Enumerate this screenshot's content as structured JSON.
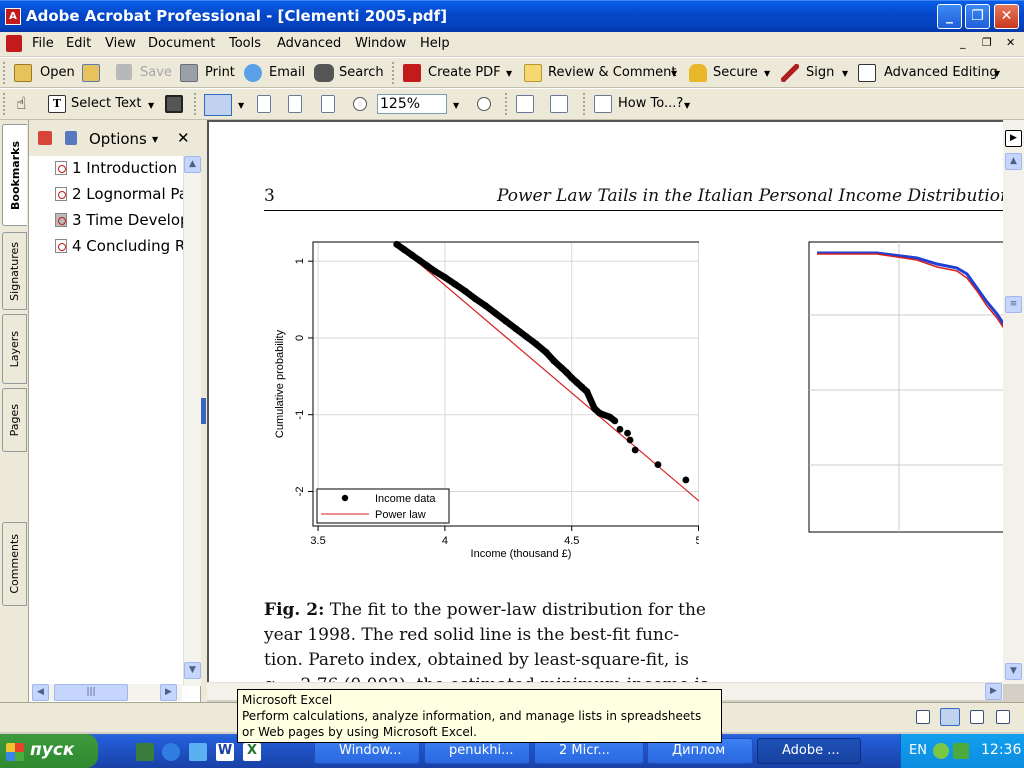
{
  "window": {
    "title": "Adobe Acrobat Professional - [Clementi 2005.pdf]",
    "icon": "acrobat-icon"
  },
  "menu": [
    "File",
    "Edit",
    "View",
    "Document",
    "Tools",
    "Advanced",
    "Window",
    "Help"
  ],
  "toolbar1": {
    "open": "Open",
    "save": "Save",
    "print": "Print",
    "email": "Email",
    "search": "Search",
    "create_pdf": "Create PDF",
    "review": "Review & Comment",
    "secure": "Secure",
    "sign": "Sign",
    "advanced": "Advanced Editing"
  },
  "toolbar2": {
    "select_text": "Select Text",
    "zoom": "125%",
    "howto": "How To...?"
  },
  "side_tabs": [
    "Bookmarks",
    "Signatures",
    "Layers",
    "Pages",
    "Comments"
  ],
  "bookmarks": {
    "options": "Options",
    "items": [
      "1 Introduction",
      "2 Lognormal Pa",
      "3 Time Develop",
      "4 Concluding R"
    ]
  },
  "pdf": {
    "page_number": "3",
    "running_title": "Power Law Tails in the Italian Personal Income Distribution",
    "caption_lines": [
      [
        "Fig. 2:",
        " The fit to the power-law distribution for the"
      ],
      [
        "",
        "year 1998.  The red solid line is the best-fit func-"
      ],
      [
        "",
        "tion.  Pareto index, obtained by least-square-fit, is"
      ],
      [
        "",
        "α = 2.76 (0.002), the estimated minimum income is"
      ]
    ]
  },
  "chart_data": {
    "type": "scatter",
    "title": "",
    "xlabel": "Income (thousand £)",
    "ylabel": "Cumulative probability",
    "xlim": [
      3.48,
      5.12
    ],
    "ylim": [
      -2.45,
      1.25
    ],
    "x_ticks": [
      "3.5",
      "4",
      "4.5",
      "5"
    ],
    "x_tick_values": [
      3.5,
      4.0,
      4.5,
      5.0
    ],
    "y_ticks": [
      "1",
      "0",
      "-1",
      "-2"
    ],
    "y_tick_values": [
      1,
      0,
      -1,
      -2
    ],
    "grid": true,
    "legend_position": "bottom-left",
    "series": [
      {
        "name": "Income data",
        "kind": "points",
        "color": "#000000",
        "x": [
          3.81,
          3.84,
          3.87,
          3.9,
          3.93,
          3.96,
          4.0,
          4.04,
          4.08,
          4.12,
          4.16,
          4.2,
          4.24,
          4.28,
          4.32,
          4.36,
          4.4,
          4.43,
          4.46,
          4.48,
          4.5,
          4.52,
          4.54,
          4.56,
          4.59,
          4.61,
          4.65,
          4.67,
          4.69,
          4.72,
          4.73,
          4.75,
          4.84,
          4.95,
          5.04
        ],
        "y": [
          1.22,
          1.15,
          1.08,
          1.01,
          0.94,
          0.87,
          0.79,
          0.7,
          0.61,
          0.51,
          0.42,
          0.32,
          0.22,
          0.12,
          0.02,
          -0.08,
          -0.19,
          -0.3,
          -0.39,
          -0.45,
          -0.52,
          -0.58,
          -0.64,
          -0.7,
          -0.92,
          -0.98,
          -1.03,
          -1.08,
          -1.19,
          -1.24,
          -1.33,
          -1.46,
          -1.65,
          -1.85,
          -2.13
        ]
      },
      {
        "name": "Power law",
        "kind": "line",
        "color": "#d62020",
        "x": [
          3.81,
          5.1
        ],
        "y": [
          1.22,
          -2.4
        ]
      }
    ]
  },
  "chart2": {
    "legend_colors": [
      "#1f3fd6",
      "#d62020"
    ]
  },
  "status": {
    "tooltip_title": "Microsoft Excel",
    "tooltip_text": "Perform calculations, analyze information, and manage lists in spreadsheets or Web pages by using Microsoft Excel."
  },
  "taskbar": {
    "start": "пуск",
    "tasks": [
      "Window...",
      "penukhi...",
      "2 Micr...",
      "Диплом",
      "Adobe ..."
    ],
    "lang": "EN",
    "clock": "12:36"
  }
}
